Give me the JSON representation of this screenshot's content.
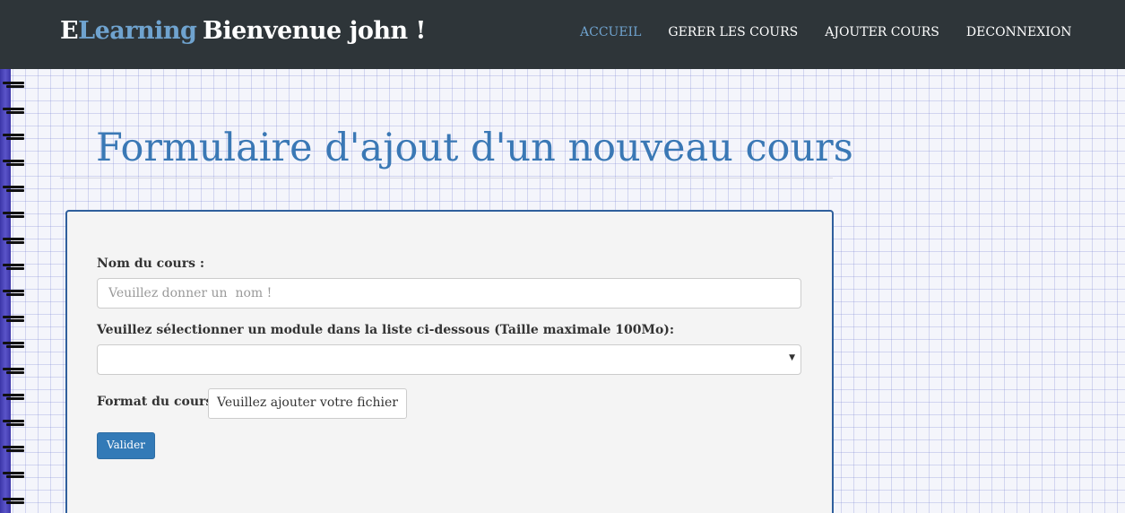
{
  "header": {
    "brand_first": "E",
    "brand_rest": "Learning",
    "welcome": "Bienvenue  john !",
    "nav": [
      {
        "label": "ACCUEIL",
        "active": true
      },
      {
        "label": "GERER LES COURS",
        "active": false
      },
      {
        "label": "AJOUTER COURS",
        "active": false
      },
      {
        "label": "DECONNEXION",
        "active": false
      }
    ]
  },
  "page": {
    "title": "Formulaire d'ajout d'un nouveau cours"
  },
  "form": {
    "name_label": "Nom du cours :",
    "name_placeholder": "Veuillez donner un  nom !",
    "name_value": "",
    "module_label": "Veuillez sélectionner un module dans la liste ci-dessous (Taille maximale 100Mo):",
    "module_selected": "",
    "format_label": "Format du cours :",
    "file_button": "Veuillez ajouter votre fichier",
    "submit_label": "Valider"
  },
  "colors": {
    "navbar": "#2e3539",
    "accent": "#6fa3cf",
    "title": "#3a78b5",
    "panel_border": "#2f5f9c",
    "button": "#337ab7"
  },
  "icons": {
    "select_arrow": "caret-down-icon",
    "notebook_binding": "spiral-binding-icon"
  }
}
